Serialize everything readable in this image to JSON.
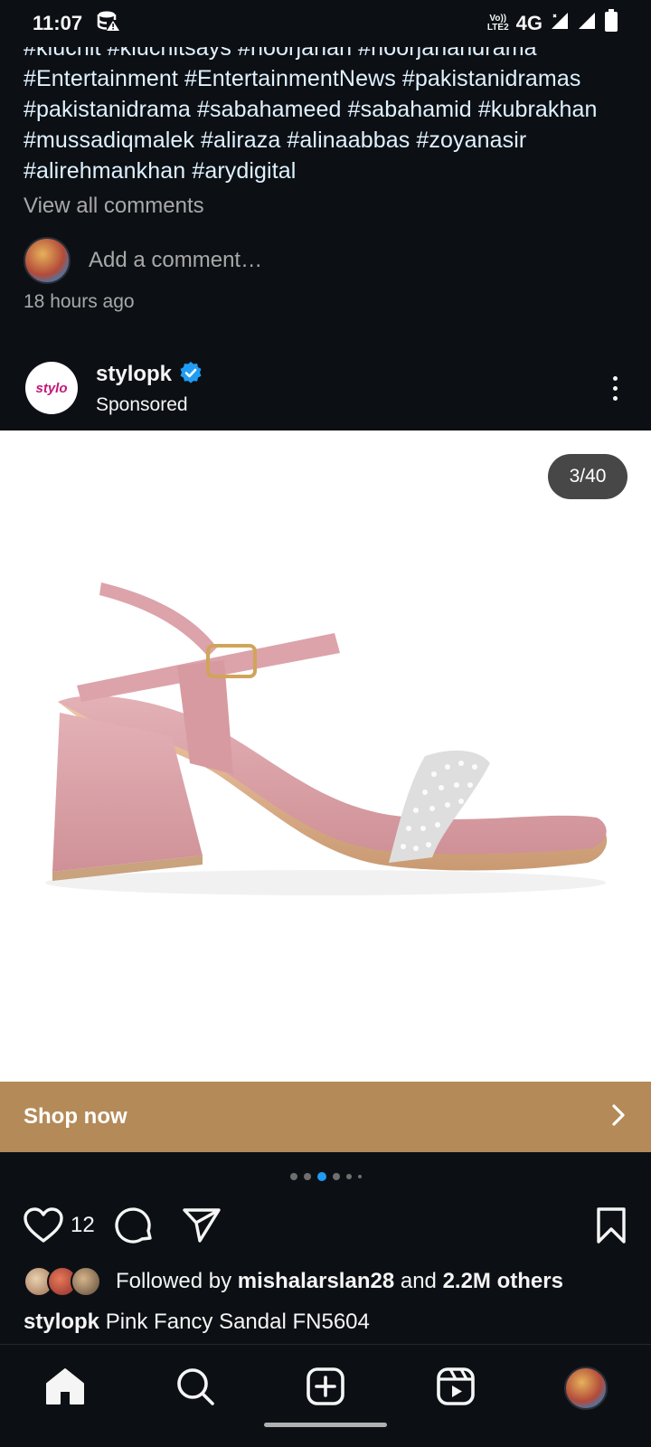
{
  "status_bar": {
    "time": "11:07",
    "network": "4G",
    "lte_top": "Vo))",
    "lte_bottom": "LTE2"
  },
  "previous_post": {
    "hashtags": "#kluchit #kluchitsays #noorjahan #noorjahandrama #Entertainment #EntertainmentNews #pakistanidramas #pakistanidrama #sabahameed #sabahamid #kubrakhan #mussadiqmalek #aliraza #alinaabbas #zoyanasir #alirehmankhan #arydigital",
    "view_all_comments": "View all comments",
    "add_comment_placeholder": "Add a comment…",
    "time_ago": "18 hours ago"
  },
  "post": {
    "brand_logo_text": "stylo",
    "username": "stylopk",
    "verified": true,
    "sponsored_label": "Sponsored",
    "carousel_position": "3/40",
    "carousel_current": 3,
    "carousel_total": 40,
    "shop_now_label": "Shop now",
    "like_count": "12",
    "followed_by_prefix": "Followed by ",
    "followed_by_user": "mishalarslan28",
    "followed_by_and": " and ",
    "followed_by_others": "2.2M others",
    "caption_user": "stylopk",
    "caption_text": " Pink Fancy Sandal FN5604"
  },
  "colors": {
    "background": "#0c1014",
    "hashtag": "#e0f1ff",
    "muted": "#a8a8a8",
    "shop_bar": "#b48a58",
    "verified": "#1f9df5",
    "active_dot": "#1f9df5"
  },
  "icons": {
    "like": "heart-icon",
    "comment": "comment-icon",
    "share": "send-icon",
    "save": "bookmark-icon",
    "nav": [
      "home-icon",
      "search-icon",
      "create-icon",
      "reels-icon",
      "profile-avatar"
    ]
  }
}
